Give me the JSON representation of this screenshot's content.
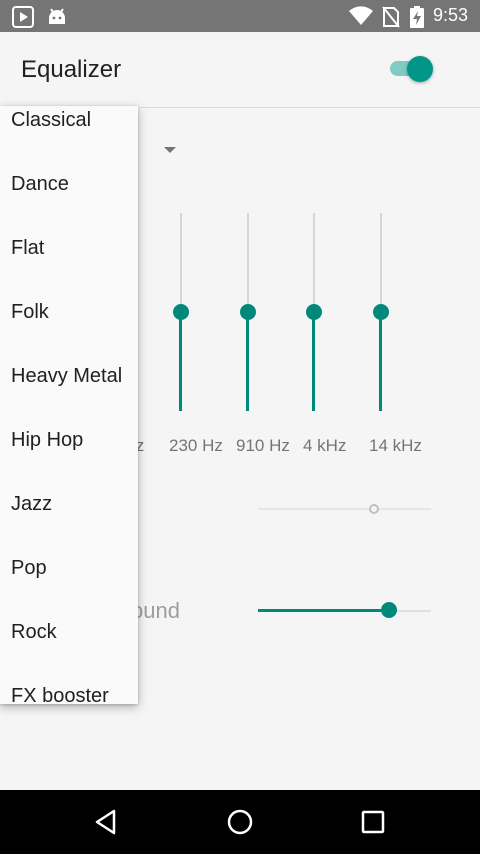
{
  "status_bar": {
    "time": "9:53",
    "icons": [
      "play-store-icon",
      "android-icon",
      "wifi-icon",
      "no-sim-icon",
      "battery-charging-icon"
    ]
  },
  "app_bar": {
    "title": "Equalizer",
    "toggle_on": true
  },
  "equalizer": {
    "bands": [
      {
        "label": "230 Hz",
        "level": 0.5
      },
      {
        "label": "910 Hz",
        "level": 0.5
      },
      {
        "label": "4 kHz",
        "level": 0.5
      },
      {
        "label": "14 kHz",
        "level": 0.5
      }
    ],
    "partial_band_label": "lz"
  },
  "bass_boost": {
    "level": 0.67
  },
  "surround": {
    "label_fragment": "ound",
    "level": 0.76
  },
  "preset_menu": {
    "items": [
      "Classical",
      "Dance",
      "Flat",
      "Folk",
      "Heavy Metal",
      "Hip Hop",
      "Jazz",
      "Pop",
      "Rock",
      "FX booster"
    ]
  },
  "nav_bar": {
    "buttons": [
      "back-icon",
      "home-icon",
      "recents-icon"
    ]
  },
  "colors": {
    "accent": "#00897b",
    "status_bar": "#757575",
    "background": "#f5f5f5"
  }
}
